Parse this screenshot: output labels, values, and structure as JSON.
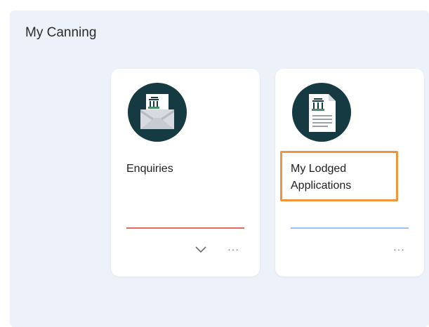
{
  "page": {
    "title": "My Canning"
  },
  "tiles": [
    {
      "label": "Enquiries",
      "icon": "enquiries-envelope-icon",
      "accent_color": "#e0675f",
      "has_expand_chevron": true,
      "more_label": "···"
    },
    {
      "label": "My Lodged Applications",
      "icon": "lodged-applications-document-icon",
      "accent_color": "#9cc3ee",
      "has_expand_chevron": false,
      "more_label": "···",
      "highlighted": true,
      "highlight_color": "#f0953b"
    }
  ],
  "colors": {
    "panel_background": "#edf1f9",
    "icon_circle": "#163a42"
  }
}
